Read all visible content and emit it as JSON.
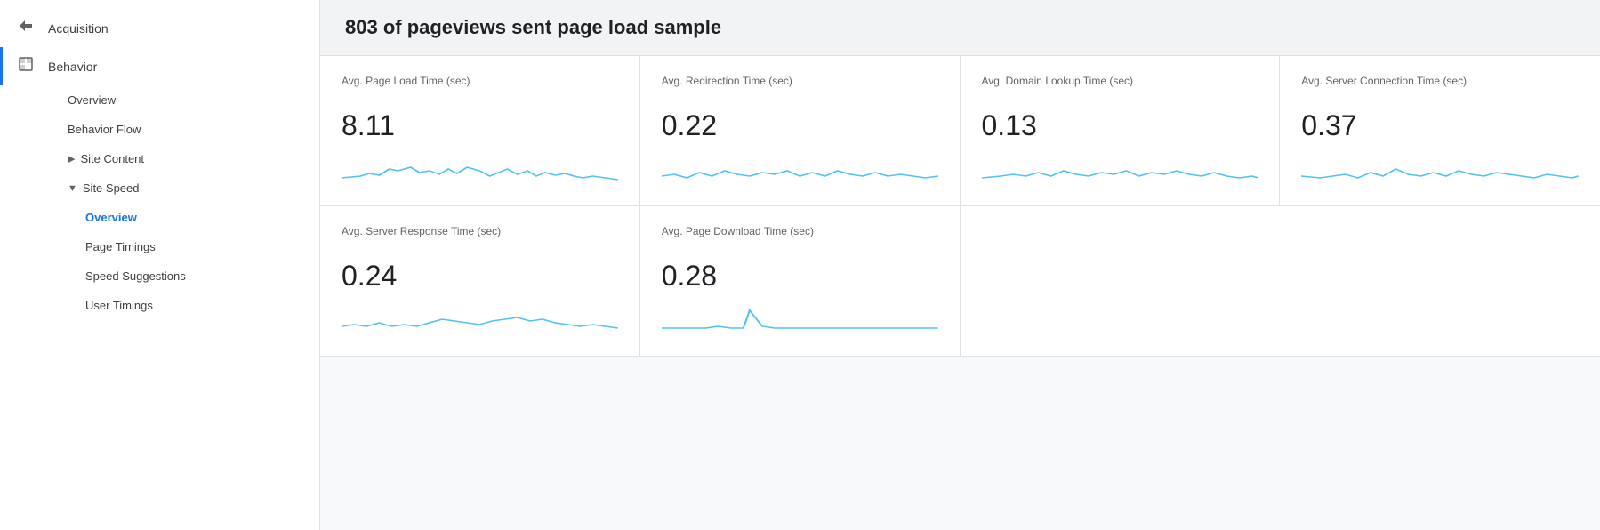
{
  "sidebar": {
    "items": [
      {
        "id": "acquisition",
        "label": "Acquisition",
        "icon": "→",
        "active": false
      },
      {
        "id": "behavior",
        "label": "Behavior",
        "icon": "▣",
        "active": true
      }
    ],
    "sub_items": [
      {
        "id": "overview",
        "label": "Overview",
        "indent": false,
        "active": false
      },
      {
        "id": "behavior-flow",
        "label": "Behavior Flow",
        "indent": false,
        "active": false
      },
      {
        "id": "site-content",
        "label": "Site Content",
        "indent": false,
        "active": false,
        "arrow": "▶"
      },
      {
        "id": "site-speed",
        "label": "Site Speed",
        "indent": false,
        "active": false,
        "arrow": "▼"
      },
      {
        "id": "ss-overview",
        "label": "Overview",
        "indent": true,
        "active": true
      },
      {
        "id": "page-timings",
        "label": "Page Timings",
        "indent": true,
        "active": false
      },
      {
        "id": "speed-suggestions",
        "label": "Speed Suggestions",
        "indent": true,
        "active": false
      },
      {
        "id": "user-timings",
        "label": "User Timings",
        "indent": true,
        "active": false
      }
    ]
  },
  "header": {
    "title": "803 of pageviews sent page load sample"
  },
  "metrics_row1": [
    {
      "id": "avg-page-load",
      "label": "Avg. Page Load Time (sec)",
      "value": "8.11",
      "chart_id": "chart1"
    },
    {
      "id": "avg-redirection",
      "label": "Avg. Redirection Time (sec)",
      "value": "0.22",
      "chart_id": "chart2"
    },
    {
      "id": "avg-domain-lookup",
      "label": "Avg. Domain Lookup Time (sec)",
      "value": "0.13",
      "chart_id": "chart3"
    },
    {
      "id": "avg-server-connection",
      "label": "Avg. Server Connection Time (sec)",
      "value": "0.37",
      "chart_id": "chart4"
    }
  ],
  "metrics_row2": [
    {
      "id": "avg-server-response",
      "label": "Avg. Server Response Time (sec)",
      "value": "0.24",
      "chart_id": "chart5"
    },
    {
      "id": "avg-page-download",
      "label": "Avg. Page Download Time (sec)",
      "value": "0.28",
      "chart_id": "chart6"
    }
  ]
}
